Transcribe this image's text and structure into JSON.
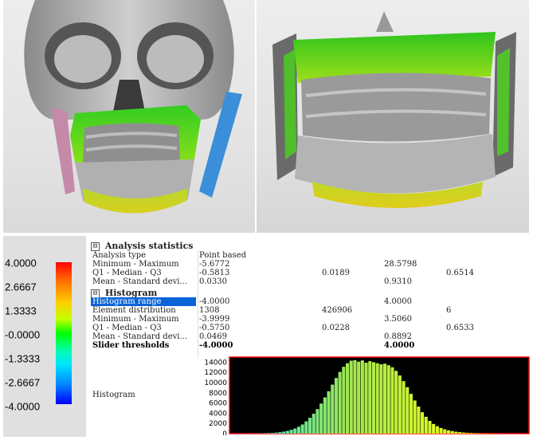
{
  "legend": {
    "labels": [
      "4.0000",
      "2.6667",
      "1.3333",
      "-0.0000",
      "-1.3333",
      "-2.6667",
      "-4.0000"
    ]
  },
  "analysis_statistics": {
    "toggle": "⊟",
    "title": "Analysis statistics",
    "rows": [
      [
        "Analysis type",
        "Point based",
        "",
        "",
        ""
      ],
      [
        "Minimum - Maximum",
        "-5.6772",
        "",
        "28.5798",
        ""
      ],
      [
        "Q1 - Median - Q3",
        "-0.5813",
        "0.0189",
        "",
        "0.6514"
      ],
      [
        "Mean - Standard devi...",
        "0.0330",
        "",
        "0.9310",
        ""
      ]
    ]
  },
  "histogram_section": {
    "toggle": "⊟",
    "title": "Histogram",
    "rows": [
      [
        "Histogram range",
        "-4.0000",
        "",
        "4.0000",
        ""
      ],
      [
        "Element distribution",
        "1308",
        "426906",
        "",
        "6"
      ],
      [
        "Minimum - Maximum",
        "-3.9999",
        "",
        "3.5060",
        ""
      ],
      [
        "Q1 - Median - Q3",
        "-0.5750",
        "0.0228",
        "",
        "0.6533"
      ],
      [
        "Mean - Standard devi...",
        "0.0469",
        "",
        "0.8892",
        ""
      ],
      [
        "Slider thresholds",
        "-4.0000",
        "",
        "4.0000",
        ""
      ]
    ],
    "histogram_label": "Histogram"
  },
  "chart_data": {
    "type": "bar",
    "title": "",
    "xlabel": "",
    "ylabel": "",
    "ylim": [
      0,
      15000
    ],
    "yticks": [
      "14000",
      "12000",
      "10000",
      "8000",
      "6000",
      "4000",
      "2000",
      "0"
    ],
    "x": [
      -4.0,
      -3.9,
      -3.8,
      -3.7,
      -3.6,
      -3.5,
      -3.4,
      -3.3,
      -3.2,
      -3.1,
      -3.0,
      -2.9,
      -2.8,
      -2.7,
      -2.6,
      -2.5,
      -2.4,
      -2.3,
      -2.2,
      -2.1,
      -2.0,
      -1.9,
      -1.8,
      -1.7,
      -1.6,
      -1.5,
      -1.4,
      -1.3,
      -1.2,
      -1.1,
      -1.0,
      -0.9,
      -0.8,
      -0.7,
      -0.6,
      -0.5,
      -0.4,
      -0.3,
      -0.2,
      -0.1,
      0.0,
      0.1,
      0.2,
      0.3,
      0.4,
      0.5,
      0.6,
      0.7,
      0.8,
      0.9,
      1.0,
      1.1,
      1.2,
      1.3,
      1.4,
      1.5,
      1.6,
      1.7,
      1.8,
      1.9,
      2.0,
      2.1,
      2.2,
      2.3,
      2.4,
      2.5,
      2.6,
      2.7,
      2.8,
      2.9,
      3.0,
      3.1,
      3.2,
      3.3,
      3.4,
      3.5,
      3.6,
      3.7,
      3.8,
      3.9
    ],
    "values": [
      10,
      12,
      15,
      18,
      22,
      28,
      35,
      45,
      60,
      80,
      110,
      150,
      210,
      290,
      400,
      550,
      750,
      1000,
      1350,
      1800,
      2400,
      3100,
      3900,
      4800,
      5900,
      7100,
      8300,
      9600,
      10900,
      12100,
      13100,
      13800,
      14300,
      14400,
      14100,
      14350,
      13900,
      14200,
      14000,
      13800,
      13600,
      13700,
      13400,
      13000,
      12300,
      11400,
      10300,
      9100,
      7800,
      6500,
      5300,
      4200,
      3300,
      2500,
      1900,
      1450,
      1100,
      850,
      650,
      500,
      380,
      290,
      220,
      170,
      130,
      100,
      80,
      60,
      45,
      35,
      28,
      22,
      18,
      14,
      11,
      9,
      7,
      5,
      4,
      3
    ],
    "bar_colors": "yellow-green-cyan gradient by x value",
    "background": "#000000",
    "border_color": "#ff0000"
  },
  "colors": {
    "selected_row": "#0a64d8",
    "chart_background": "#000000",
    "chart_border": "#ff0000"
  }
}
